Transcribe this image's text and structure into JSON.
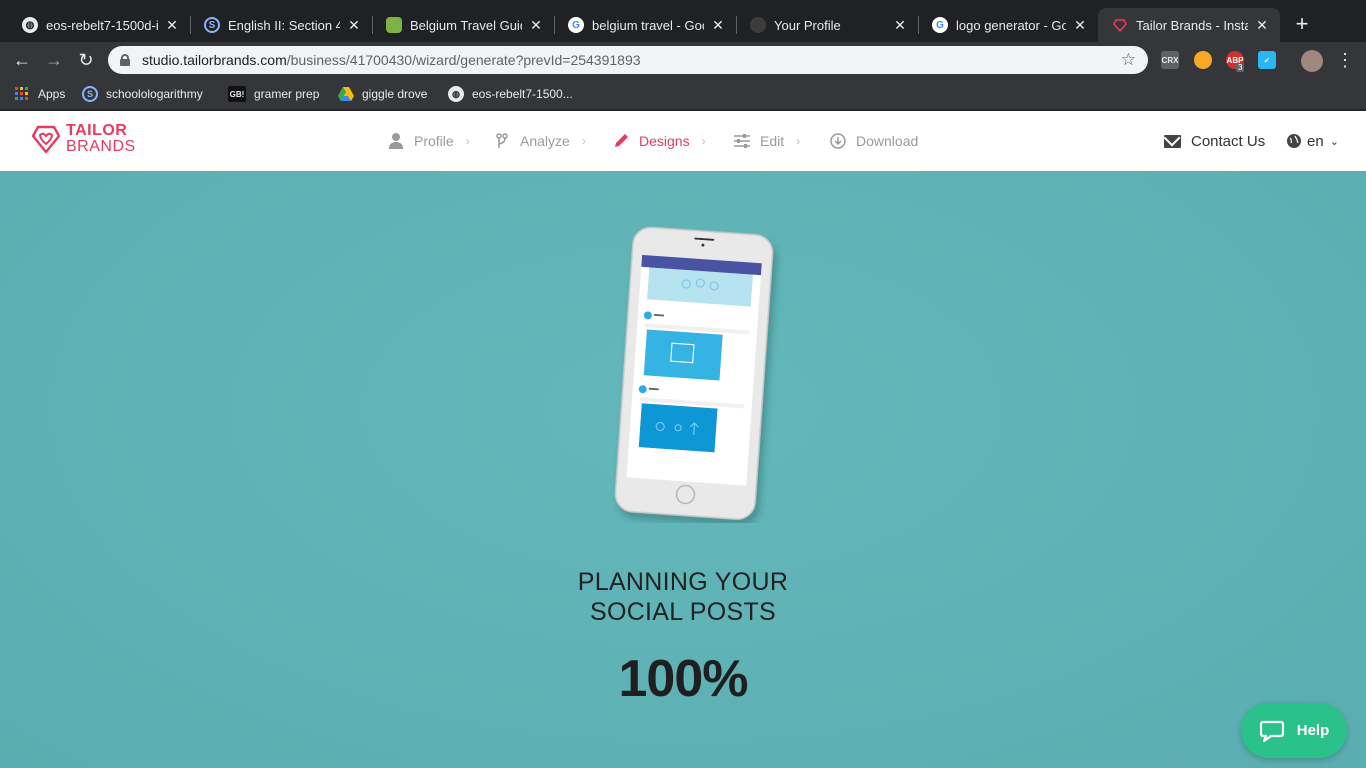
{
  "browser": {
    "tabs": [
      {
        "title": "eos-rebelt7-1500d-i",
        "favicon": "globe-icon"
      },
      {
        "title": "English II: Section 4 |",
        "favicon": "schoology-icon"
      },
      {
        "title": "Belgium Travel Guide",
        "favicon": "travel-guide-icon"
      },
      {
        "title": "belgium travel - Goo",
        "favicon": "google-icon"
      },
      {
        "title": "Your Profile",
        "favicon": "github-icon"
      },
      {
        "title": "logo generator - Goo",
        "favicon": "google-icon"
      },
      {
        "title": "Tailor Brands - Insta",
        "favicon": "tailor-brands-icon",
        "active": true
      }
    ],
    "url_host": "studio.tailorbrands.com",
    "url_path": "/business/41700430/wizard/generate?prevId=254391893",
    "extensions": [
      {
        "name": "crx-extension",
        "label": "CRX"
      },
      {
        "name": "owl-extension",
        "label": ""
      },
      {
        "name": "adblock-extension",
        "label": "ABP",
        "badge": "3"
      },
      {
        "name": "checkmark-extension",
        "label": ""
      }
    ],
    "bookmarks": [
      {
        "label": "Apps",
        "icon": "apps-grid-icon"
      },
      {
        "label": "schoolologarithmy",
        "icon": "schoology-icon"
      },
      {
        "label": "gramer prep",
        "icon": "gb-icon",
        "icon_text": "GB!"
      },
      {
        "label": "giggle drove",
        "icon": "google-drive-icon"
      },
      {
        "label": "eos-rebelt7-1500...",
        "icon": "globe-icon"
      }
    ]
  },
  "site": {
    "logo_line1": "TAILOR",
    "logo_line2": "BRANDS",
    "steps": [
      {
        "label": "Profile",
        "icon": "user-icon",
        "active": false
      },
      {
        "label": "Analyze",
        "icon": "branch-icon",
        "active": false
      },
      {
        "label": "Designs",
        "icon": "pencil-icon",
        "active": true
      },
      {
        "label": "Edit",
        "icon": "sliders-icon",
        "active": false
      },
      {
        "label": "Download",
        "icon": "download-icon",
        "active": false
      }
    ],
    "contact_label": "Contact Us",
    "language": "en"
  },
  "main": {
    "status_line1": "PLANNING YOUR",
    "status_line2": "SOCIAL POSTS",
    "progress_text": "100%",
    "progress": 1.0,
    "help_label": "Help"
  },
  "colors": {
    "brand": "#e8395f",
    "background": "#5fb3b6",
    "help": "#2bc18a"
  }
}
